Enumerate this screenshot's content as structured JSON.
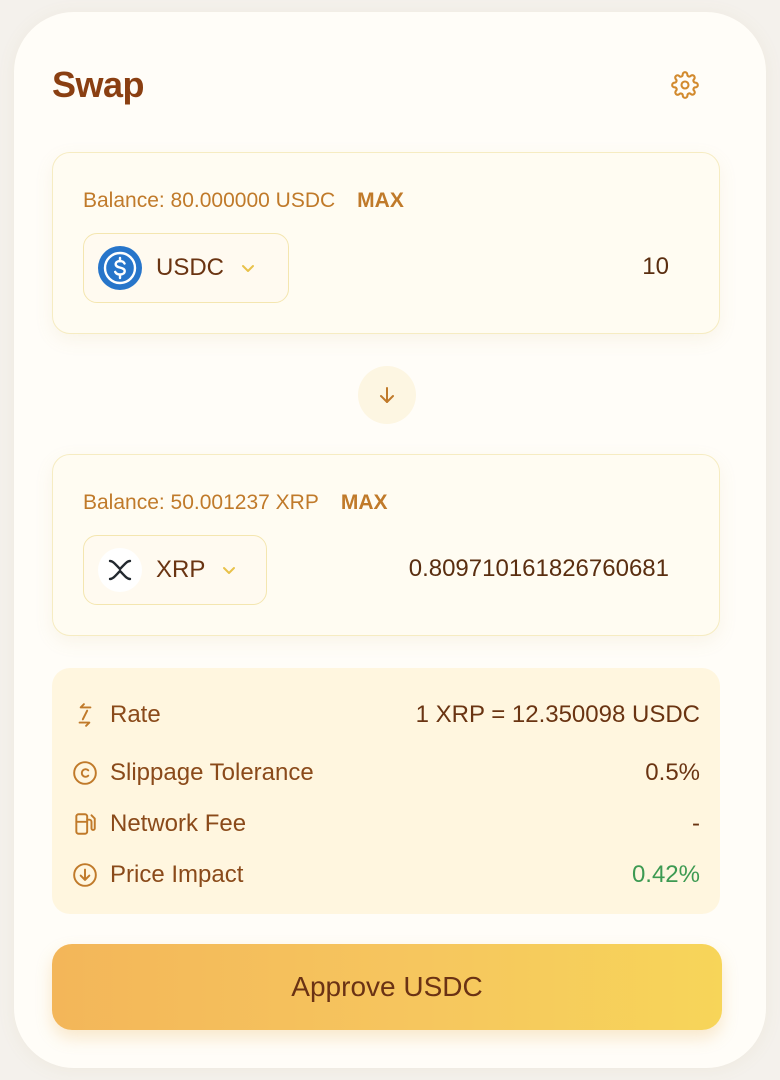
{
  "header": {
    "title": "Swap",
    "settings_icon": "gear-icon"
  },
  "from": {
    "balance_label": "Balance: 80.000000 USDC",
    "max_label": "MAX",
    "token": {
      "symbol": "USDC",
      "icon": "usdc-logo-icon",
      "color": "#2775ca"
    },
    "amount": "10"
  },
  "switch_icon": "arrow-down-icon",
  "to": {
    "balance_label": "Balance: 50.001237 XRP",
    "max_label": "MAX",
    "token": {
      "symbol": "XRP",
      "icon": "xrp-logo-icon",
      "color": "#23292f"
    },
    "amount": "0.809710161826760681"
  },
  "details": [
    {
      "icon": "swap-arrows-icon",
      "label": "Rate",
      "value": "1 XRP = 12.350098 USDC"
    },
    {
      "icon": "copyright-circle-icon",
      "label": "Slippage Tolerance",
      "value": "0.5%"
    },
    {
      "icon": "fuel-pump-icon",
      "label": "Network Fee",
      "value": "-"
    },
    {
      "icon": "arrow-down-circle-icon",
      "label": "Price Impact",
      "value": "0.42%",
      "value_color": "#3d9a52"
    }
  ],
  "action": {
    "label": "Approve USDC"
  },
  "colors": {
    "accent": "#c07a2a",
    "title": "#8a3f12",
    "positive": "#3d9a52"
  }
}
